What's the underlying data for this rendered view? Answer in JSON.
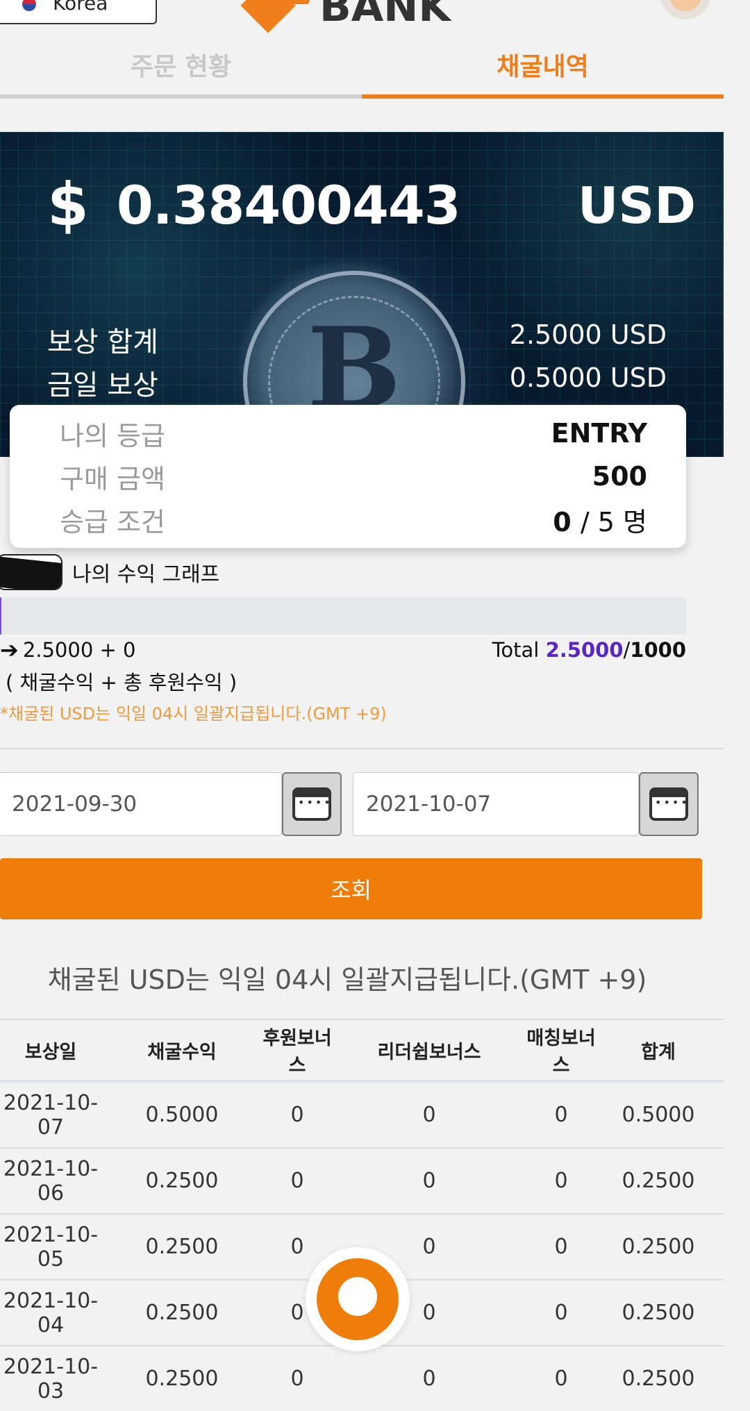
{
  "header": {
    "language": "Korea",
    "logo_text": "BANK"
  },
  "tabs": [
    {
      "label": "주문 현황",
      "active": false
    },
    {
      "label": "채굴내역",
      "active": true
    }
  ],
  "hero": {
    "currency_symbol": "$",
    "balance": "0.38400443",
    "currency": "USD",
    "rows": [
      {
        "label": "보상 합계",
        "value": "2.5000 USD"
      },
      {
        "label": "금일 보상",
        "value": "0.5000 USD"
      }
    ]
  },
  "grade": {
    "rows": [
      {
        "label": "나의 등급",
        "value": "ENTRY"
      },
      {
        "label": "구매 금액",
        "value": "500"
      }
    ],
    "promotion_label": "승급 조건",
    "promotion_current": "0",
    "promotion_rest": "/ 5 명"
  },
  "graph": {
    "title": "나의 수익 그래프",
    "progress_fraction": 0.0025,
    "formula": "2.5000 + 0",
    "formula_desc": "( 채굴수익 + 총 후원수익 )",
    "total_label": "Total",
    "total_value": "2.5000",
    "total_max": "1000",
    "note": "*채굴된 USD는 익일 04시 일괄지급됩니다.(GMT +9)"
  },
  "filter": {
    "start_date": "2021-09-30",
    "end_date": "2021-10-07",
    "search_label": "조회"
  },
  "notice": "채굴된 USD는 익일 04시 일괄지급됩니다.(GMT +9)",
  "table": {
    "headers": [
      "보상일",
      "채굴수익",
      "후원보너스",
      "리더쉽보너스",
      "매칭보너스",
      "합계"
    ],
    "rows": [
      [
        "2021-10-07",
        "0.5000",
        "0",
        "0",
        "0",
        "0.5000"
      ],
      [
        "2021-10-06",
        "0.2500",
        "0",
        "0",
        "0",
        "0.2500"
      ],
      [
        "2021-10-05",
        "0.2500",
        "0",
        "0",
        "0",
        "0.2500"
      ],
      [
        "2021-10-04",
        "0.2500",
        "0",
        "0",
        "0",
        "0.2500"
      ],
      [
        "2021-10-03",
        "0.2500",
        "0",
        "0",
        "0",
        "0.2500"
      ]
    ]
  },
  "colors": {
    "accent": "#ef7d0a",
    "purple": "#5b26c6"
  }
}
